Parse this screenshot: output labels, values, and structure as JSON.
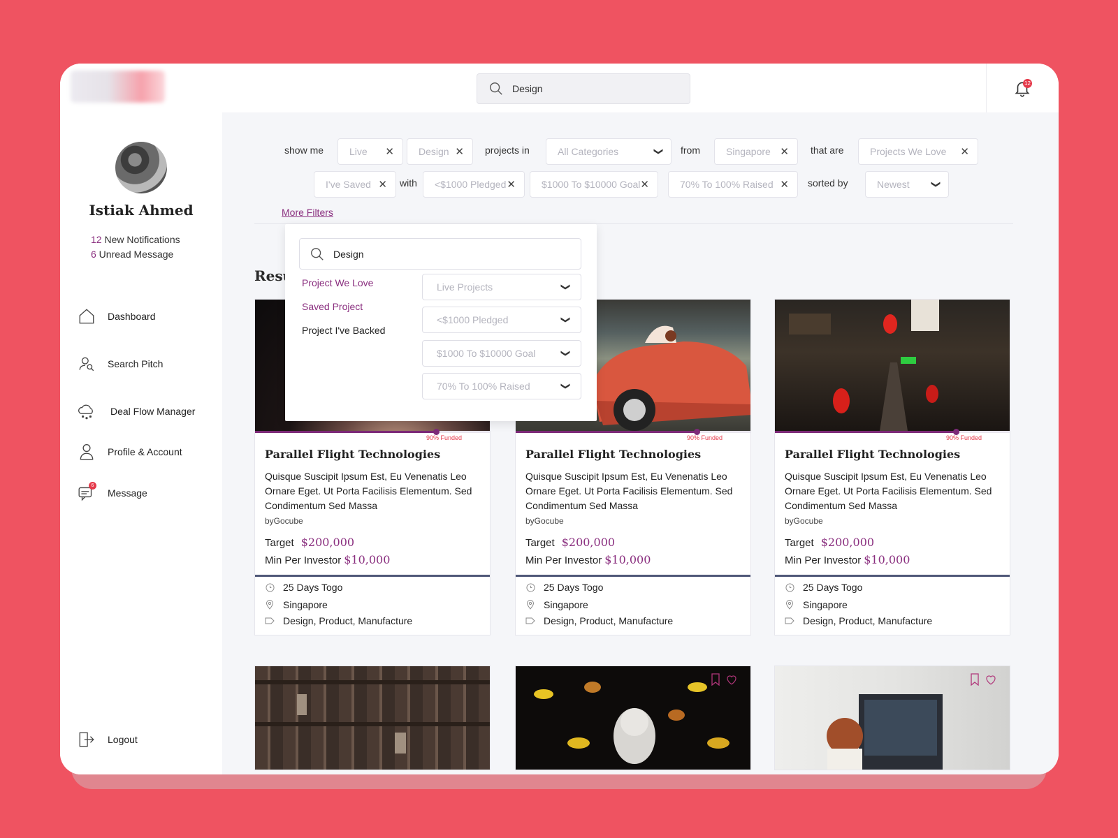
{
  "header": {
    "search_value": "Design",
    "notification_count": "12"
  },
  "sidebar": {
    "user_name": "Istiak Ahmed",
    "notifications_count": "12",
    "notifications_label": " New Notifications",
    "unread_count": "6",
    "unread_label": " Unread Message",
    "nav": [
      {
        "label": "Dashboard",
        "icon": "home-icon"
      },
      {
        "label": "Search Pitch",
        "icon": "search-user-icon"
      },
      {
        "label": "Deal Flow Manager",
        "icon": "cloud-network-icon"
      },
      {
        "label": "Profile & Account",
        "icon": "user-icon"
      },
      {
        "label": "Message",
        "icon": "chat-icon",
        "badge": "6"
      }
    ],
    "logout_label": "Logout"
  },
  "filters": {
    "show_me": "show me",
    "live": "Live",
    "design": "Design",
    "projects_in": "projects in",
    "categories": "All Categories",
    "from": "from",
    "location": "Singapore",
    "that_are": "that are",
    "projects_we_love": "Projects We Love",
    "ive_saved": "I've Saved",
    "with": "with",
    "pledged": "<$1000 Pledged",
    "goal": "$1000 To $10000 Goal",
    "raised": "70% To 100% Raised",
    "sorted_by": "sorted by",
    "sort": "Newest",
    "more_filters": "More Filters"
  },
  "results_label": "Results",
  "dropdown": {
    "search_value": "Design",
    "links": [
      "Project We Love",
      "Saved Project",
      "Project I've Backed"
    ],
    "selects": [
      "Live Projects",
      "<$1000 Pledged",
      "$1000 To $10000 Goal",
      "70% To 100% Raised"
    ]
  },
  "cards": [
    {
      "funded_label": "90% Funded",
      "funded_fraction": 0.77,
      "title": "Parallel Flight Technologies",
      "description": "Quisque Suscipit Ipsum Est, Eu Venenatis Leo Ornare Eget. Ut Porta Facilisis Elementum. Sed Condimentum Sed Massa",
      "by": "byGocube",
      "target_label": "Target",
      "target": "$200,000",
      "min_label": "Min Per Investor",
      "min": "$10,000",
      "days": "25 Days Togo",
      "location": "Singapore",
      "tags": "Design, Product, Manufacture"
    },
    {
      "funded_label": "90% Funded",
      "funded_fraction": 0.77,
      "title": "Parallel Flight Technologies",
      "description": "Quisque Suscipit Ipsum Est, Eu Venenatis Leo Ornare Eget. Ut Porta Facilisis Elementum. Sed Condimentum Sed Massa",
      "by": "byGocube",
      "target_label": "Target",
      "target": "$200,000",
      "min_label": "Min Per Investor",
      "min": "$10,000",
      "days": "25 Days Togo",
      "location": "Singapore",
      "tags": "Design, Product, Manufacture"
    },
    {
      "funded_label": "90% Funded",
      "funded_fraction": 0.77,
      "title": "Parallel Flight Technologies",
      "description": "Quisque Suscipit Ipsum Est, Eu Venenatis Leo Ornare Eget. Ut Porta Facilisis Elementum. Sed Condimentum Sed Massa",
      "by": "byGocube",
      "target_label": "Target",
      "target": "$200,000",
      "min_label": "Min Per Investor",
      "min": "$10,000",
      "days": "25 Days Togo",
      "location": "Singapore",
      "tags": "Design, Product, Manufacture"
    }
  ],
  "colors": {
    "accent": "#8a2f7f",
    "background": "#ef5361",
    "badge": "#e5394a"
  }
}
